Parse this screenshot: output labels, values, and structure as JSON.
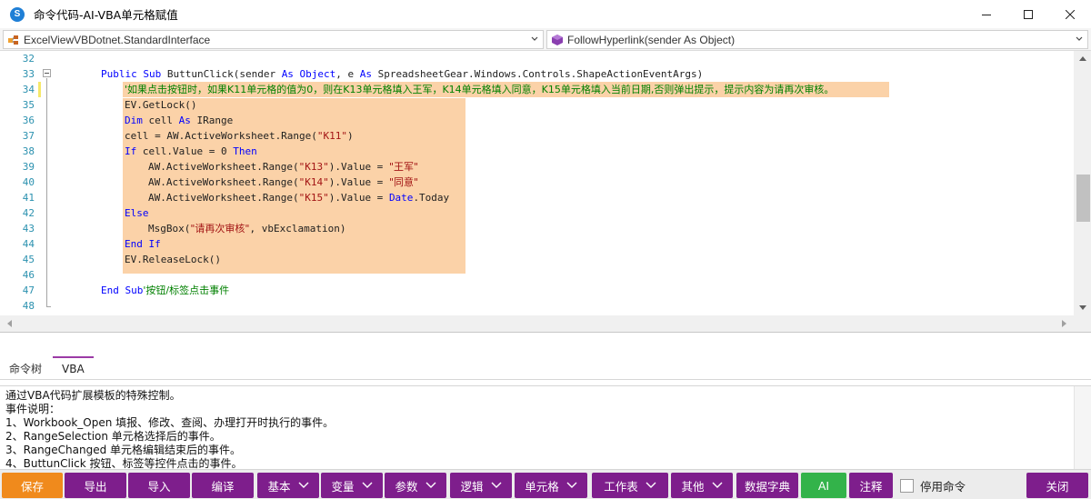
{
  "window": {
    "title": "命令代码-AI-VBA单元格赋值",
    "app_icon_letter": "S"
  },
  "nav": {
    "class_combo": "ExcelViewVBDotnet.StandardInterface",
    "method_combo": "FollowHyperlink(sender As Object)"
  },
  "editor": {
    "line_numbers": [
      "32",
      "33",
      "34",
      "35",
      "36",
      "37",
      "38",
      "39",
      "40",
      "41",
      "42",
      "43",
      "44",
      "45",
      "46",
      "47",
      "48"
    ],
    "code": {
      "l33_a": "Public Sub",
      "l33_b": " ButtunClick(sender ",
      "l33_c": "As Object",
      "l33_d": ", e ",
      "l33_e": "As",
      "l33_f": " SpreadsheetGear.Windows.Controls.ShapeActionEventArgs)",
      "l34": "'如果点击按钮时，如果K11单元格的值为0，则在K13单元格填入王军，K14单元格填入同意，K15单元格填入当前日期,否则弹出提示，提示内容为请再次审核。",
      "l35": "EV.GetLock()",
      "l36_a": "Dim",
      "l36_b": " cell ",
      "l36_c": "As",
      "l36_d": " IRange",
      "l37_a": "cell = AW.ActiveWorksheet.Range(",
      "l37_b": "\"K11\"",
      "l37_c": ")",
      "l38_a": "If",
      "l38_b": " cell.Value = 0 ",
      "l38_c": "Then",
      "l39_a": "AW.ActiveWorksheet.Range(",
      "l39_b": "\"K13\"",
      "l39_c": ").Value = ",
      "l39_d": "\"王军\"",
      "l40_a": "AW.ActiveWorksheet.Range(",
      "l40_b": "\"K14\"",
      "l40_c": ").Value = ",
      "l40_d": "\"同意\"",
      "l41_a": "AW.ActiveWorksheet.Range(",
      "l41_b": "\"K15\"",
      "l41_c": ").Value = ",
      "l41_d": "Date",
      "l41_e": ".Today",
      "l42": "Else",
      "l43_a": "MsgBox(",
      "l43_b": "\"请再次审核\"",
      "l43_c": ", vbExclamation)",
      "l44": "End If",
      "l45": "EV.ReleaseLock()",
      "l47_a": "End Sub",
      "l47_b": "'按钮/标签点击事件"
    }
  },
  "tabs": [
    {
      "label": "命令树",
      "active": false
    },
    {
      "label": "VBA",
      "active": true
    }
  ],
  "description": [
    "通过VBA代码扩展模板的特殊控制。",
    "事件说明：",
    "1、Workbook_Open 填报、修改、查阅、办理打开时执行的事件。",
    "2、RangeSelection 单元格选择后的事件。",
    "3、RangeChanged 单元格编辑结束后的事件。",
    "4、ButtunClick 按钮、标签等控件点击的事件。"
  ],
  "toolbar": {
    "save": "保存",
    "export": "导出",
    "import": "导入",
    "compile": "编译",
    "basic": "基本",
    "variable": "变量",
    "parameter": "参数",
    "logic": "逻辑",
    "cell": "单元格",
    "worksheet": "工作表",
    "other": "其他",
    "dictionary": "数据字典",
    "ai": "AI",
    "comment": "注释",
    "disable_cmd": "停用命令",
    "close": "关闭"
  },
  "colors": {
    "accent_purple": "#7e1e8c",
    "save_orange": "#f08a1c",
    "ai_green": "#33b34a",
    "highlight": "#fbd2a8"
  }
}
